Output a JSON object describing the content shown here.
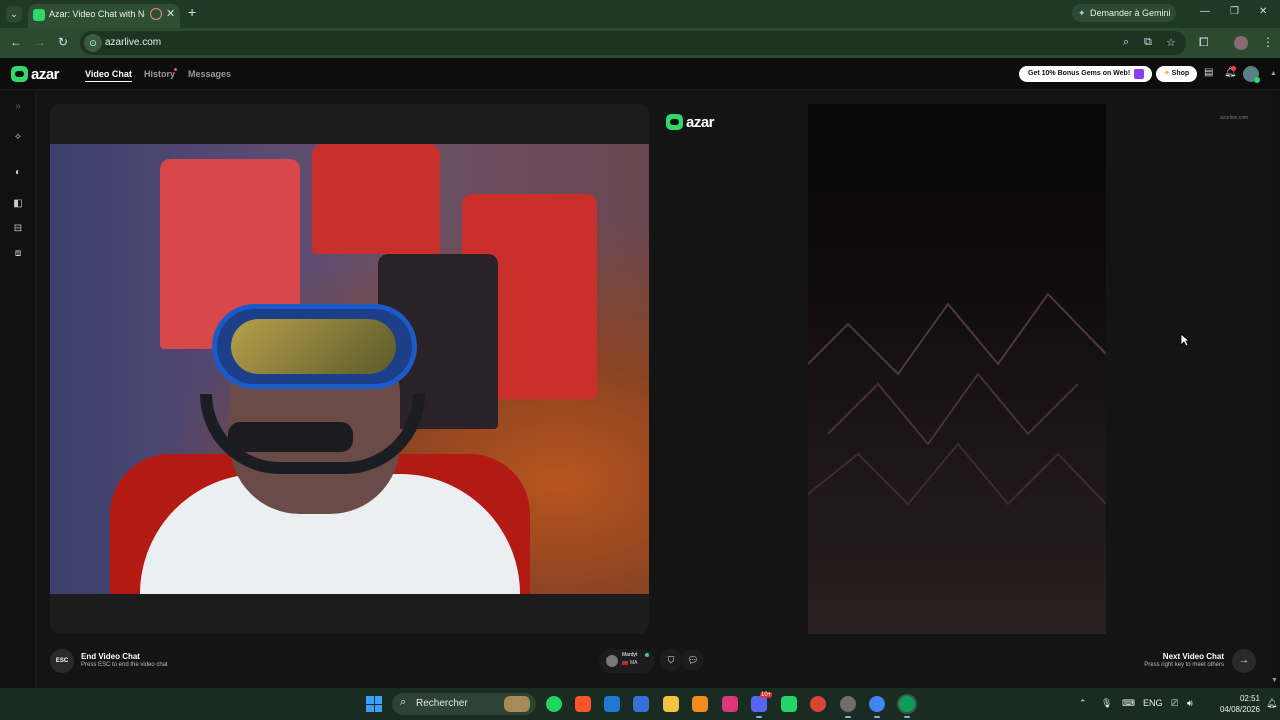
{
  "browser": {
    "tab_title": "Azar: Video Chat with New",
    "new_tab_icon": "+",
    "gemini_label": "Demander à Gemini",
    "url": "azarlive.com"
  },
  "app": {
    "brand": "azar",
    "nav": [
      {
        "label": "Video Chat",
        "active": true
      },
      {
        "label": "History",
        "active": false,
        "has_badge": true
      },
      {
        "label": "Messages",
        "active": false
      }
    ],
    "gems_label": "Get 10% Bonus Gems on Web!",
    "shop_label": "Shop",
    "watermark": "azarlive.com"
  },
  "controls": {
    "esc_key": "ESC",
    "end_title": "End Video Chat",
    "end_hint": "Press ESC to end the video chat",
    "partner_name": "Mardyt",
    "partner_country": "MA",
    "next_title": "Next Video Chat",
    "next_hint": "Press right key to meet others"
  },
  "taskbar": {
    "search_label": "Rechercher",
    "language": "ENG",
    "time": "02:51",
    "date": "04/08/2026",
    "notification_count": "10+"
  },
  "colors": {
    "brand_green": "#2fd86a",
    "chrome_frame": "#1f3a24",
    "app_background": "#141414",
    "badge_red": "#ff3b4e"
  }
}
